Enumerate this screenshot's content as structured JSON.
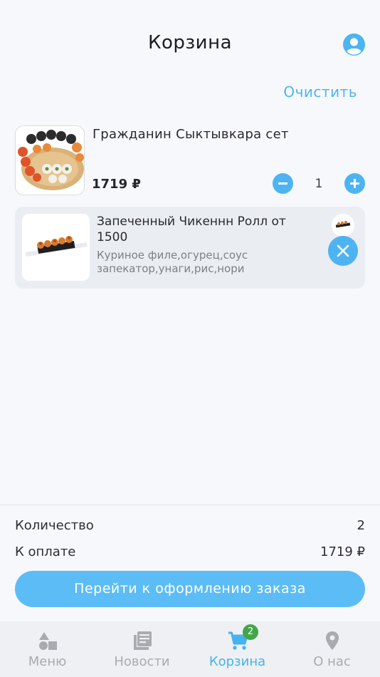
{
  "header": {
    "title": "Корзина",
    "profile_icon": "account-circle-icon"
  },
  "actions": {
    "clear_label": "Очистить"
  },
  "cart_item": {
    "name": "Гражданин Сыктывкара сет",
    "price": "1719 ₽",
    "quantity": "1"
  },
  "addon": {
    "name": "Запеченный Чикеннн Ролл от 1500",
    "description": "Куриное филе,огурец,соус запекатор,унаги,рис,нори"
  },
  "summary": {
    "count_label": "Количество",
    "count_value": "2",
    "pay_label": "К оплате",
    "pay_value": "1719 ₽"
  },
  "checkout": {
    "label": "Перейти к оформлению заказа"
  },
  "tabs": [
    {
      "label": "Меню",
      "icon": "shapes-icon",
      "active": false
    },
    {
      "label": "Новости",
      "icon": "news-icon",
      "active": false
    },
    {
      "label": "Корзина",
      "icon": "cart-icon",
      "active": true
    },
    {
      "label": "О нас",
      "icon": "location-pin-icon",
      "active": false
    }
  ],
  "badge": {
    "count": "2"
  },
  "colors": {
    "accent": "#4eb4f1",
    "badge": "#43a649",
    "background": "#f7f8fb"
  }
}
